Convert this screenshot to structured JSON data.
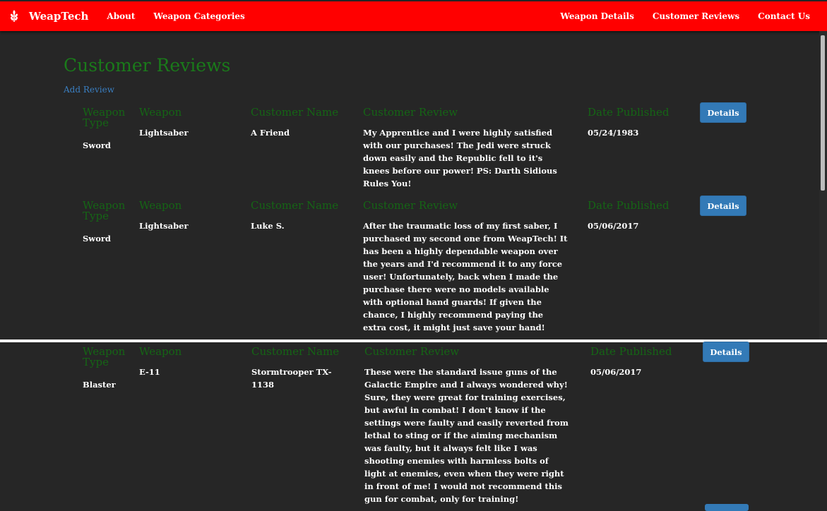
{
  "nav": {
    "brand": "WeapTech",
    "brand_icon": "wheat-icon",
    "left_links": [
      "About",
      "Weapon Categories"
    ],
    "right_links": [
      "Weapon Details",
      "Customer Reviews",
      "Contact Us"
    ]
  },
  "page": {
    "title": "Customer Reviews",
    "add_review": "Add Review"
  },
  "headers": {
    "weapon_type": "Weapon Type",
    "weapon": "Weapon",
    "customer_name": "Customer Name",
    "customer_review": "Customer Review",
    "date_published": "Date Published"
  },
  "reviews": [
    {
      "weapon_type": "Sword",
      "weapon": "Lightsaber",
      "customer_name": "A Friend",
      "review": "My Apprentice and I were highly satisfied with our purchases! The Jedi were struck down easily and the Republic fell to it's knees before our power! PS: Darth Sidious Rules You!",
      "date": "05/24/1983",
      "button": "Details"
    },
    {
      "weapon_type": "Sword",
      "weapon": "Lightsaber",
      "customer_name": "Luke S.",
      "review": "After the traumatic loss of my first saber, I purchased my second one from WeapTech! It has been a highly dependable weapon over the years and I'd recommend it to any force user! Unfortunately, back when I made the purchase there were no models available with optional hand guards! If given the chance, I highly recommend paying the extra cost, it might just save your hand!",
      "date": "05/06/2017",
      "button": "Details"
    },
    {
      "weapon_type": "Blaster",
      "weapon": "E-11",
      "customer_name": "Stormtrooper TX-1138",
      "review": "These were the standard issue guns of the Galactic Empire and I always wondered why! Sure, they were great for training exercises, but awful in combat! I don't know if the settings were faulty and easily reverted from lethal to sting or if the aiming mechanism was faulty, but it always felt like I was shooting enemies with harmless bolts of light at enemies, even when they were right in front of me! I would not recommend this gun for combat, only for training!",
      "date": "05/06/2017",
      "button": "Details"
    }
  ]
}
